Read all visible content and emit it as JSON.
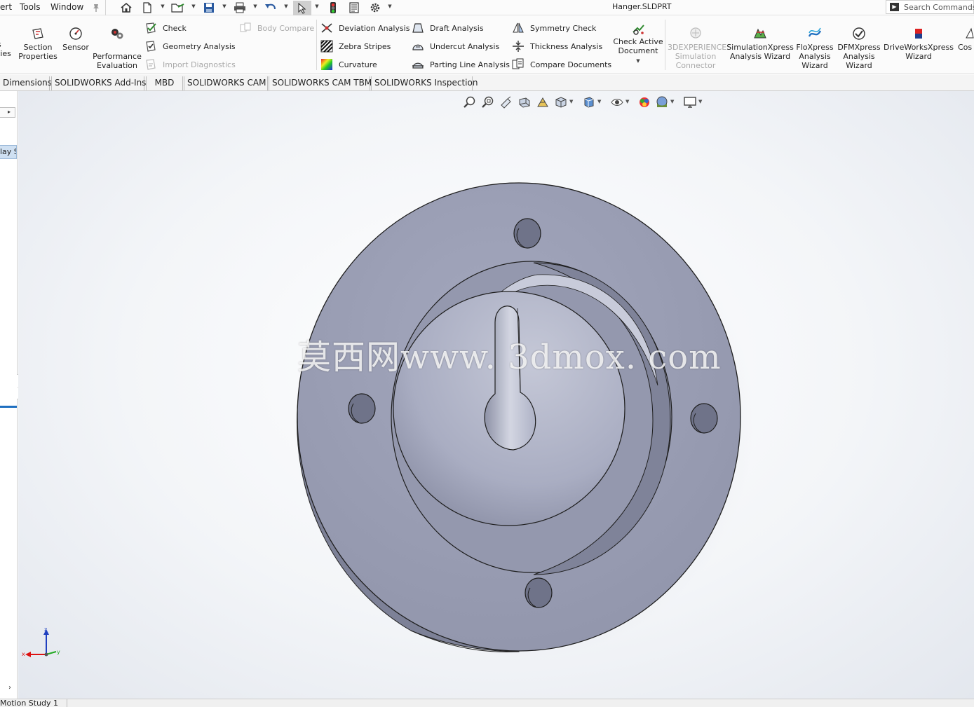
{
  "menu": {
    "insert_label": "ert",
    "tools_label": "Tools",
    "window_label": "Window"
  },
  "title": {
    "document": "Hanger.SLDPRT"
  },
  "search": {
    "placeholder": "Search Commands"
  },
  "ribbon": {
    "partial_left": {
      "line1": "s",
      "line2": "ties"
    },
    "section_properties": {
      "line1": "Section",
      "line2": "Properties"
    },
    "sensor": "Sensor",
    "performance": {
      "line1": "Performance",
      "line2": "Evaluation"
    },
    "check": "Check",
    "geometry_analysis": "Geometry Analysis",
    "import_diagnostics": "Import Diagnostics",
    "body_compare": "Body Compare",
    "deviation_analysis": "Deviation Analysis",
    "zebra_stripes": "Zebra Stripes",
    "curvature": "Curvature",
    "draft_analysis": "Draft Analysis",
    "undercut_analysis": "Undercut Analysis",
    "parting_line_analysis": "Parting Line Analysis",
    "symmetry_check": "Symmetry Check",
    "thickness_analysis": "Thickness Analysis",
    "compare_documents": "Compare Documents",
    "check_active_document": {
      "line1": "Check Active",
      "line2": "Document"
    },
    "experience_connector": {
      "line1": "3DEXPERIENCE",
      "line2": "Simulation",
      "line3": "Connector"
    },
    "simulationxpress": {
      "line1": "SimulationXpress",
      "line2": "Analysis Wizard"
    },
    "floxpress": {
      "line1": "FloXpress",
      "line2": "Analysis",
      "line3": "Wizard"
    },
    "dfmxpress": {
      "line1": "DFMXpress",
      "line2": "Analysis",
      "line3": "Wizard"
    },
    "driveworksxpress": {
      "line1": "DriveWorksXpress",
      "line2": "Wizard"
    },
    "partial_right": "Cos"
  },
  "tabs": [
    "Dimensions",
    "SOLIDWORKS Add-Ins",
    "MBD",
    "SOLIDWORKS CAM",
    "SOLIDWORKS CAM TBM",
    "SOLIDWORKS Inspection"
  ],
  "left_panel": {
    "tab_label": "lay S"
  },
  "triad": {
    "z": "z",
    "x": "x",
    "y": "y"
  },
  "watermark": "莫西网www. 3dmox. com",
  "bottom": {
    "motion_study": "Motion Study 1"
  },
  "colors": {
    "part_face": "#9b9fb5",
    "part_side": "#7d8197",
    "accent_blue": "#1f6fc0"
  }
}
